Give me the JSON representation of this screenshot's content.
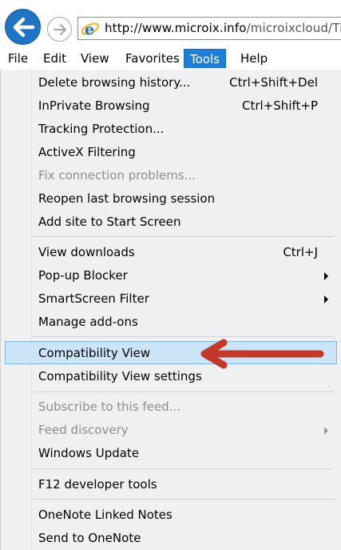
{
  "address_bar": {
    "url_domain": "http://www.microix.info",
    "url_path": "/microixcloud/Tim",
    "back_icon": "back-arrow-icon",
    "forward_icon": "forward-arrow-icon",
    "page_icon": "internet-explorer-icon"
  },
  "menubar": {
    "items": [
      {
        "label": "File"
      },
      {
        "label": "Edit"
      },
      {
        "label": "View"
      },
      {
        "label": "Favorites"
      },
      {
        "label": "Tools",
        "active": true
      },
      {
        "label": "Help"
      }
    ]
  },
  "tools_menu": {
    "groups": [
      [
        {
          "label": "Delete browsing history...",
          "shortcut": "Ctrl+Shift+Del"
        },
        {
          "label": "InPrivate Browsing",
          "shortcut": "Ctrl+Shift+P"
        },
        {
          "label": "Tracking Protection..."
        },
        {
          "label": "ActiveX Filtering"
        },
        {
          "label": "Fix connection problems...",
          "disabled": true
        },
        {
          "label": "Reopen last browsing session"
        },
        {
          "label": "Add site to Start Screen"
        }
      ],
      [
        {
          "label": "View downloads",
          "shortcut": "Ctrl+J"
        },
        {
          "label": "Pop-up Blocker",
          "submenu": true
        },
        {
          "label": "SmartScreen Filter",
          "submenu": true
        },
        {
          "label": "Manage add-ons"
        }
      ],
      [
        {
          "label": "Compatibility View",
          "highlighted": true
        },
        {
          "label": "Compatibility View settings"
        }
      ],
      [
        {
          "label": "Subscribe to this feed...",
          "disabled": true
        },
        {
          "label": "Feed discovery",
          "disabled": true,
          "submenu": true
        },
        {
          "label": "Windows Update"
        }
      ],
      [
        {
          "label": "F12 developer tools"
        }
      ],
      [
        {
          "label": "OneNote Linked Notes"
        },
        {
          "label": "Send to OneNote"
        }
      ]
    ]
  },
  "annotation": {
    "arrow_color": "#c0392b",
    "highlight_color": "#cce4f7"
  }
}
